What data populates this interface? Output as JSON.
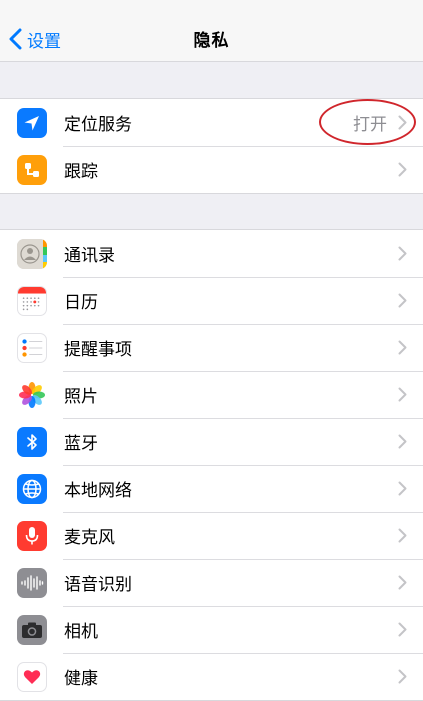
{
  "nav": {
    "back_label": "设置",
    "title": "隐私"
  },
  "section1": [
    {
      "label": "定位服务",
      "value": "打开",
      "icon": "location-arrow-icon",
      "color": "#0a7aff"
    },
    {
      "label": "跟踪",
      "icon": "tracking-icon",
      "color": "#ff9f0a"
    }
  ],
  "section2": [
    {
      "label": "通讯录",
      "icon": "contacts-icon"
    },
    {
      "label": "日历",
      "icon": "calendar-icon"
    },
    {
      "label": "提醒事项",
      "icon": "reminders-icon"
    },
    {
      "label": "照片",
      "icon": "photos-icon"
    },
    {
      "label": "蓝牙",
      "icon": "bluetooth-icon",
      "color": "#0a7aff"
    },
    {
      "label": "本地网络",
      "icon": "globe-icon",
      "color": "#0a7aff"
    },
    {
      "label": "麦克风",
      "icon": "microphone-icon",
      "color": "#ff3b30"
    },
    {
      "label": "语音识别",
      "icon": "waveform-icon",
      "color": "#8e8e93"
    },
    {
      "label": "相机",
      "icon": "camera-icon",
      "color": "#8e8e93"
    },
    {
      "label": "健康",
      "icon": "heart-icon",
      "color": "#ff2d55"
    }
  ],
  "colors": {
    "accent": "#007aff",
    "annotation": "#d0262c"
  }
}
